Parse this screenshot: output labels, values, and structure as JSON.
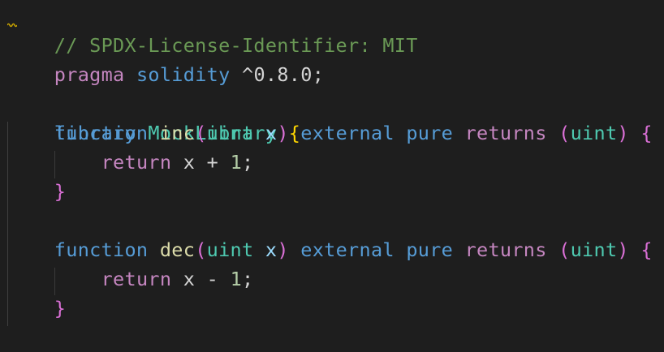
{
  "code": {
    "comment": "// SPDX-License-Identifier: MIT",
    "pragma": {
      "keyword": "pragma",
      "name": "solidity",
      "version": "^0.8.0",
      "semicolon": ";"
    },
    "library": {
      "keyword": "library",
      "name": "MockLibrary",
      "open_brace": "{",
      "functions": [
        {
          "keyword": "function",
          "name": "inc",
          "open_paren": "(",
          "param_type": "uint",
          "param_name": "x",
          "close_paren": ")",
          "visibility": "external",
          "mutability": "pure",
          "returns_kw": "returns",
          "ret_open": "(",
          "return_type": "uint",
          "ret_close": ")",
          "open_brace": "{",
          "body_keyword": "return",
          "body_var": "x",
          "body_op": "+",
          "body_num": "1",
          "body_semicolon": ";",
          "close_brace": "}"
        },
        {
          "keyword": "function",
          "name": "dec",
          "open_paren": "(",
          "param_type": "uint",
          "param_name": "x",
          "close_paren": ")",
          "visibility": "external",
          "mutability": "pure",
          "returns_kw": "returns",
          "ret_open": "(",
          "return_type": "uint",
          "ret_close": ")",
          "open_brace": "{",
          "body_keyword": "return",
          "body_var": "x",
          "body_op": "-",
          "body_num": "1",
          "body_semicolon": ";",
          "close_brace": "}"
        }
      ]
    }
  },
  "colors": {
    "background": "#1e1e1e",
    "comment": "#6a9955",
    "control_keyword": "#c586c0",
    "storage_keyword": "#569cd6",
    "type_name": "#4ec9b0",
    "function_name": "#dcdcaa",
    "variable": "#9cdcfe",
    "number": "#b5cea8",
    "default_text": "#d4d4d4",
    "bracket_level_1": "#ffd700",
    "bracket_level_2": "#da70d6",
    "warning_squiggle": "#cca700"
  }
}
